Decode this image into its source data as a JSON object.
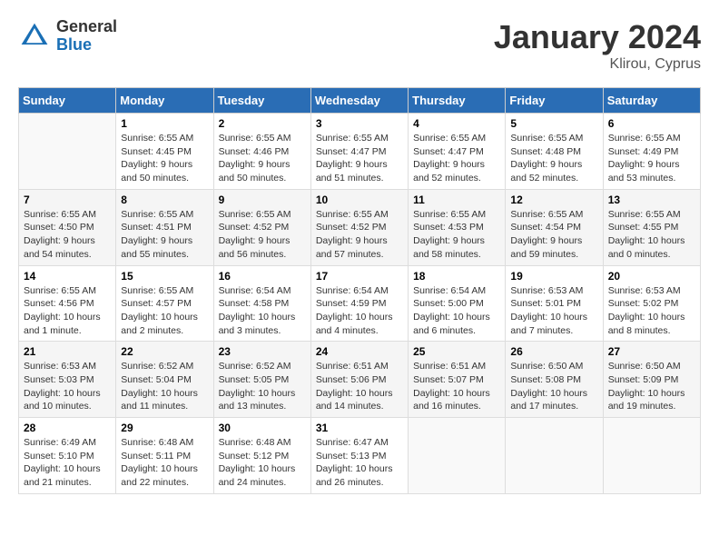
{
  "header": {
    "logo_general": "General",
    "logo_blue": "Blue",
    "month_year": "January 2024",
    "location": "Klirou, Cyprus"
  },
  "weekdays": [
    "Sunday",
    "Monday",
    "Tuesday",
    "Wednesday",
    "Thursday",
    "Friday",
    "Saturday"
  ],
  "weeks": [
    [
      {
        "day": "",
        "sunrise": "",
        "sunset": "",
        "daylight": ""
      },
      {
        "day": "1",
        "sunrise": "Sunrise: 6:55 AM",
        "sunset": "Sunset: 4:45 PM",
        "daylight": "Daylight: 9 hours and 50 minutes."
      },
      {
        "day": "2",
        "sunrise": "Sunrise: 6:55 AM",
        "sunset": "Sunset: 4:46 PM",
        "daylight": "Daylight: 9 hours and 50 minutes."
      },
      {
        "day": "3",
        "sunrise": "Sunrise: 6:55 AM",
        "sunset": "Sunset: 4:47 PM",
        "daylight": "Daylight: 9 hours and 51 minutes."
      },
      {
        "day": "4",
        "sunrise": "Sunrise: 6:55 AM",
        "sunset": "Sunset: 4:47 PM",
        "daylight": "Daylight: 9 hours and 52 minutes."
      },
      {
        "day": "5",
        "sunrise": "Sunrise: 6:55 AM",
        "sunset": "Sunset: 4:48 PM",
        "daylight": "Daylight: 9 hours and 52 minutes."
      },
      {
        "day": "6",
        "sunrise": "Sunrise: 6:55 AM",
        "sunset": "Sunset: 4:49 PM",
        "daylight": "Daylight: 9 hours and 53 minutes."
      }
    ],
    [
      {
        "day": "7",
        "sunrise": "Sunrise: 6:55 AM",
        "sunset": "Sunset: 4:50 PM",
        "daylight": "Daylight: 9 hours and 54 minutes."
      },
      {
        "day": "8",
        "sunrise": "Sunrise: 6:55 AM",
        "sunset": "Sunset: 4:51 PM",
        "daylight": "Daylight: 9 hours and 55 minutes."
      },
      {
        "day": "9",
        "sunrise": "Sunrise: 6:55 AM",
        "sunset": "Sunset: 4:52 PM",
        "daylight": "Daylight: 9 hours and 56 minutes."
      },
      {
        "day": "10",
        "sunrise": "Sunrise: 6:55 AM",
        "sunset": "Sunset: 4:52 PM",
        "daylight": "Daylight: 9 hours and 57 minutes."
      },
      {
        "day": "11",
        "sunrise": "Sunrise: 6:55 AM",
        "sunset": "Sunset: 4:53 PM",
        "daylight": "Daylight: 9 hours and 58 minutes."
      },
      {
        "day": "12",
        "sunrise": "Sunrise: 6:55 AM",
        "sunset": "Sunset: 4:54 PM",
        "daylight": "Daylight: 9 hours and 59 minutes."
      },
      {
        "day": "13",
        "sunrise": "Sunrise: 6:55 AM",
        "sunset": "Sunset: 4:55 PM",
        "daylight": "Daylight: 10 hours and 0 minutes."
      }
    ],
    [
      {
        "day": "14",
        "sunrise": "Sunrise: 6:55 AM",
        "sunset": "Sunset: 4:56 PM",
        "daylight": "Daylight: 10 hours and 1 minute."
      },
      {
        "day": "15",
        "sunrise": "Sunrise: 6:55 AM",
        "sunset": "Sunset: 4:57 PM",
        "daylight": "Daylight: 10 hours and 2 minutes."
      },
      {
        "day": "16",
        "sunrise": "Sunrise: 6:54 AM",
        "sunset": "Sunset: 4:58 PM",
        "daylight": "Daylight: 10 hours and 3 minutes."
      },
      {
        "day": "17",
        "sunrise": "Sunrise: 6:54 AM",
        "sunset": "Sunset: 4:59 PM",
        "daylight": "Daylight: 10 hours and 4 minutes."
      },
      {
        "day": "18",
        "sunrise": "Sunrise: 6:54 AM",
        "sunset": "Sunset: 5:00 PM",
        "daylight": "Daylight: 10 hours and 6 minutes."
      },
      {
        "day": "19",
        "sunrise": "Sunrise: 6:53 AM",
        "sunset": "Sunset: 5:01 PM",
        "daylight": "Daylight: 10 hours and 7 minutes."
      },
      {
        "day": "20",
        "sunrise": "Sunrise: 6:53 AM",
        "sunset": "Sunset: 5:02 PM",
        "daylight": "Daylight: 10 hours and 8 minutes."
      }
    ],
    [
      {
        "day": "21",
        "sunrise": "Sunrise: 6:53 AM",
        "sunset": "Sunset: 5:03 PM",
        "daylight": "Daylight: 10 hours and 10 minutes."
      },
      {
        "day": "22",
        "sunrise": "Sunrise: 6:52 AM",
        "sunset": "Sunset: 5:04 PM",
        "daylight": "Daylight: 10 hours and 11 minutes."
      },
      {
        "day": "23",
        "sunrise": "Sunrise: 6:52 AM",
        "sunset": "Sunset: 5:05 PM",
        "daylight": "Daylight: 10 hours and 13 minutes."
      },
      {
        "day": "24",
        "sunrise": "Sunrise: 6:51 AM",
        "sunset": "Sunset: 5:06 PM",
        "daylight": "Daylight: 10 hours and 14 minutes."
      },
      {
        "day": "25",
        "sunrise": "Sunrise: 6:51 AM",
        "sunset": "Sunset: 5:07 PM",
        "daylight": "Daylight: 10 hours and 16 minutes."
      },
      {
        "day": "26",
        "sunrise": "Sunrise: 6:50 AM",
        "sunset": "Sunset: 5:08 PM",
        "daylight": "Daylight: 10 hours and 17 minutes."
      },
      {
        "day": "27",
        "sunrise": "Sunrise: 6:50 AM",
        "sunset": "Sunset: 5:09 PM",
        "daylight": "Daylight: 10 hours and 19 minutes."
      }
    ],
    [
      {
        "day": "28",
        "sunrise": "Sunrise: 6:49 AM",
        "sunset": "Sunset: 5:10 PM",
        "daylight": "Daylight: 10 hours and 21 minutes."
      },
      {
        "day": "29",
        "sunrise": "Sunrise: 6:48 AM",
        "sunset": "Sunset: 5:11 PM",
        "daylight": "Daylight: 10 hours and 22 minutes."
      },
      {
        "day": "30",
        "sunrise": "Sunrise: 6:48 AM",
        "sunset": "Sunset: 5:12 PM",
        "daylight": "Daylight: 10 hours and 24 minutes."
      },
      {
        "day": "31",
        "sunrise": "Sunrise: 6:47 AM",
        "sunset": "Sunset: 5:13 PM",
        "daylight": "Daylight: 10 hours and 26 minutes."
      },
      {
        "day": "",
        "sunrise": "",
        "sunset": "",
        "daylight": ""
      },
      {
        "day": "",
        "sunrise": "",
        "sunset": "",
        "daylight": ""
      },
      {
        "day": "",
        "sunrise": "",
        "sunset": "",
        "daylight": ""
      }
    ]
  ]
}
